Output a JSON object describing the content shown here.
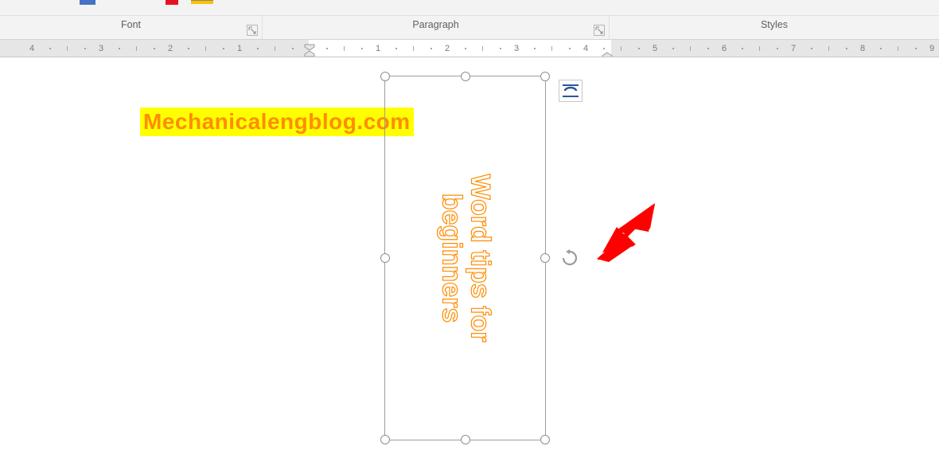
{
  "ribbon": {
    "groups": {
      "font": "Font",
      "paragraph": "Paragraph",
      "styles": "Styles"
    }
  },
  "ruler": {
    "labels_left": [
      "4",
      "3",
      "2",
      "1"
    ],
    "labels_right": [
      "1",
      "2",
      "3",
      "4",
      "5",
      "6",
      "7",
      "8",
      "9"
    ]
  },
  "document": {
    "watermark_text": "Mechanicalengblog.com",
    "textbox_text_line1": "Word tips for",
    "textbox_text_line2": "beginners"
  },
  "icons": {
    "dialog_launcher": "dialog-launcher-icon",
    "layout_options": "layout-options-icon",
    "rotate": "rotate-handle-icon"
  },
  "colors": {
    "highlight_yellow": "#ffff00",
    "text_orange": "#ff8c00",
    "arrow_red": "#ff0000",
    "selection_grey": "#9d9d9d"
  }
}
